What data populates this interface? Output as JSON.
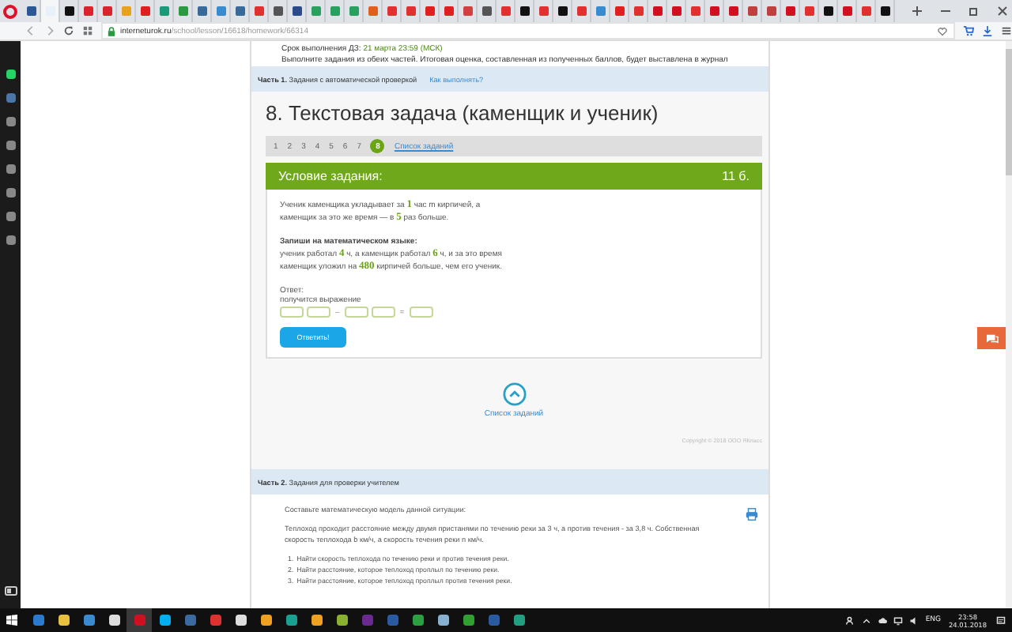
{
  "browser": {
    "tabs": [
      {
        "color": "#2b5797",
        "selected": false
      },
      {
        "color": "#e8f0f8",
        "selected": true
      },
      {
        "color": "#111111",
        "selected": false
      },
      {
        "color": "#d9232d",
        "selected": false
      },
      {
        "color": "#d9232d",
        "selected": false
      },
      {
        "color": "#e8a020",
        "selected": false
      },
      {
        "color": "#e02020",
        "selected": false
      },
      {
        "color": "#1a9a7a",
        "selected": false
      },
      {
        "color": "#2a9a40",
        "selected": false
      },
      {
        "color": "#3a6a9a",
        "selected": false
      },
      {
        "color": "#3a8ad0",
        "selected": false
      },
      {
        "color": "#3a6a9a",
        "selected": false
      },
      {
        "color": "#e03030",
        "selected": false
      },
      {
        "color": "#555555",
        "selected": false
      },
      {
        "color": "#2a4a8a",
        "selected": false
      },
      {
        "color": "#2aa060",
        "selected": false
      },
      {
        "color": "#2aa060",
        "selected": false
      },
      {
        "color": "#2aa060",
        "selected": false
      },
      {
        "color": "#e06020",
        "selected": false
      },
      {
        "color": "#e03030",
        "selected": false
      },
      {
        "color": "#e03030",
        "selected": false
      },
      {
        "color": "#e02020",
        "selected": false
      },
      {
        "color": "#e02020",
        "selected": false
      },
      {
        "color": "#d04040",
        "selected": false
      },
      {
        "color": "#555555",
        "selected": false
      },
      {
        "color": "#e03030",
        "selected": false
      },
      {
        "color": "#111111",
        "selected": false
      },
      {
        "color": "#e03030",
        "selected": false
      },
      {
        "color": "#111111",
        "selected": false
      },
      {
        "color": "#e03030",
        "selected": false
      },
      {
        "color": "#3a8ad0",
        "selected": false
      },
      {
        "color": "#e02020",
        "selected": false
      },
      {
        "color": "#e03030",
        "selected": false
      },
      {
        "color": "#d01020",
        "selected": false
      },
      {
        "color": "#d01020",
        "selected": false
      },
      {
        "color": "#e03030",
        "selected": false
      },
      {
        "color": "#d01020",
        "selected": false
      },
      {
        "color": "#d01020",
        "selected": false
      },
      {
        "color": "#c04040",
        "selected": false
      },
      {
        "color": "#c04040",
        "selected": false
      },
      {
        "color": "#d01020",
        "selected": false
      },
      {
        "color": "#e03030",
        "selected": false
      },
      {
        "color": "#111111",
        "selected": false
      },
      {
        "color": "#d01020",
        "selected": false
      },
      {
        "color": "#e03030",
        "selected": false
      },
      {
        "color": "#111111",
        "selected": false
      }
    ],
    "address": {
      "domain": "interneturok.ru",
      "path": "/school/lesson/16618/homework/66314"
    }
  },
  "header": {
    "deadline_label": "Срок выполнения ДЗ:",
    "deadline": "21 марта 23:59 (МСК)",
    "instructions": "Выполните задания из обеих частей. Итоговая оценка, составленная из полученных баллов, будет выставлена в журнал"
  },
  "part1": {
    "label": "Часть 1.",
    "title": "Задания с автоматической проверкой",
    "link": "Как выполнять?"
  },
  "task": {
    "title": "8. Текстовая задача (каменщик и ученик)",
    "pages": [
      {
        "label": "1",
        "selected": false
      },
      {
        "label": "2",
        "selected": false
      },
      {
        "label": "3",
        "selected": false
      },
      {
        "label": "4",
        "selected": false
      },
      {
        "label": "5",
        "selected": false
      },
      {
        "label": "6",
        "selected": false
      },
      {
        "label": "7",
        "selected": false
      },
      {
        "label": "8",
        "selected": true
      }
    ],
    "list_link": "Список заданий",
    "condition_title": "Условие задания:",
    "points": "11 б.",
    "paragraph1": "Ученик каменщика укладывает за **1** час m кирпичей, а каменщик за это же время — в **5** раз больше.",
    "heading2": "Запиши на математическом языке:",
    "paragraph2": "ученик работал **4** ч, а каменщик работал **6** ч, и за это время каменщик уложил на **480** кирпичей больше, чем его ученик.",
    "answer_label": "Ответ:",
    "answer_hint": "получится выражение",
    "expression": [
      {
        "kind": "box"
      },
      {
        "kind": "box"
      },
      {
        "kind": "sign",
        "text": "–"
      },
      {
        "kind": "box"
      },
      {
        "kind": "box"
      },
      {
        "kind": "sign",
        "text": "="
      },
      {
        "kind": "box"
      }
    ],
    "submit": "Ответить!"
  },
  "nav": {
    "link": "Список заданий"
  },
  "copyright": "Copyright © 2018 ООО ЯКласс",
  "part2": {
    "label": "Часть 2.",
    "title": "Задания для проверки учителем",
    "intro": "Составьте математическую модель данной ситуации:",
    "text": "Теплоход проходит расстояние между двумя пристанями по течению реки за 3 ч, а против течения - за 3,8 ч. Собственная скорость теплохода b км/ч, а скорость течения реки n км/ч.",
    "steps": [
      {
        "number": "1.",
        "text": "Найти скорость теплохода по течению реки и против течения реки."
      },
      {
        "number": "2.",
        "text": "Найти расстояние, которое теплоход проплыл по течению реки."
      },
      {
        "number": "3.",
        "text": "Найти расстояние, которое теплоход проплыл против течения реки."
      }
    ]
  },
  "taskbar": {
    "language": "ENG",
    "time": "23:58",
    "date": "24.01.2018"
  }
}
